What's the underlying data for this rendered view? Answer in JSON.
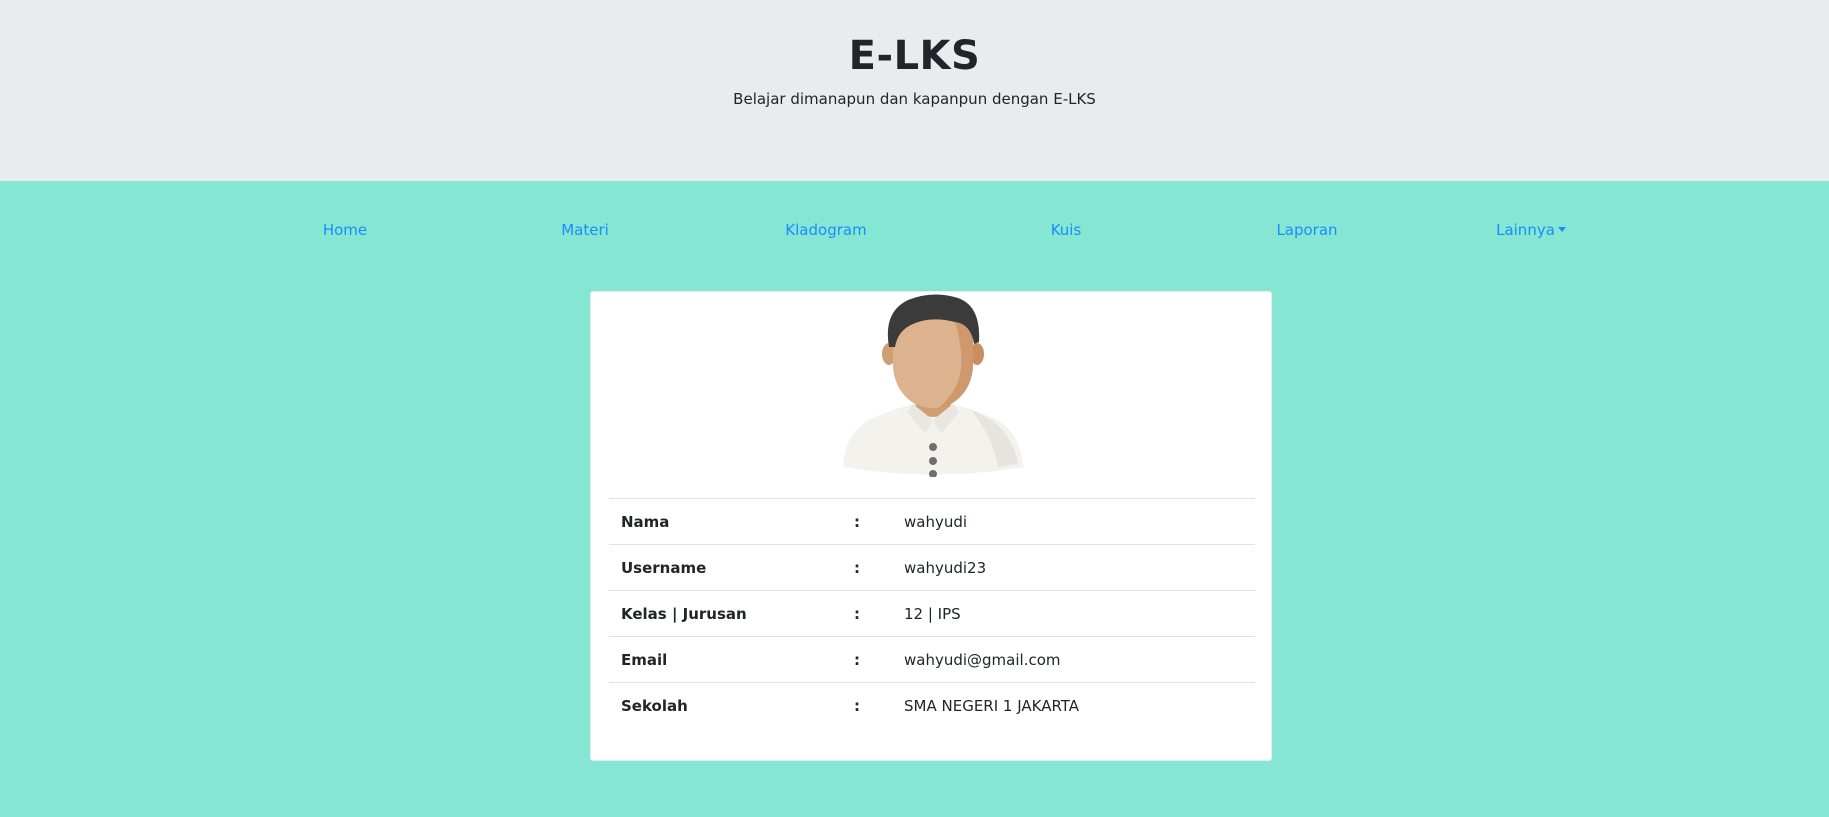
{
  "header": {
    "title": "E-LKS",
    "subtitle": "Belajar dimanapun dan kapanpun dengan E-LKS"
  },
  "nav": {
    "items": [
      {
        "label": "Home"
      },
      {
        "label": "Materi"
      },
      {
        "label": "Kladogram"
      },
      {
        "label": "Kuis"
      },
      {
        "label": "Laporan"
      },
      {
        "label": "Lainnya"
      }
    ]
  },
  "profile": {
    "separator": ":",
    "rows": [
      {
        "label": "Nama",
        "value": "wahyudi"
      },
      {
        "label": "Username",
        "value": "wahyudi23"
      },
      {
        "label": "Kelas | Jurusan",
        "value": "12 | IPS"
      },
      {
        "label": "Email",
        "value": "wahyudi@gmail.com"
      },
      {
        "label": "Sekolah",
        "value": "SMA NEGERI 1 JAKARTA"
      }
    ]
  },
  "colors": {
    "page_bg": "#86e6d4",
    "header_bg": "#e9ecef",
    "link": "#1a8cff"
  }
}
